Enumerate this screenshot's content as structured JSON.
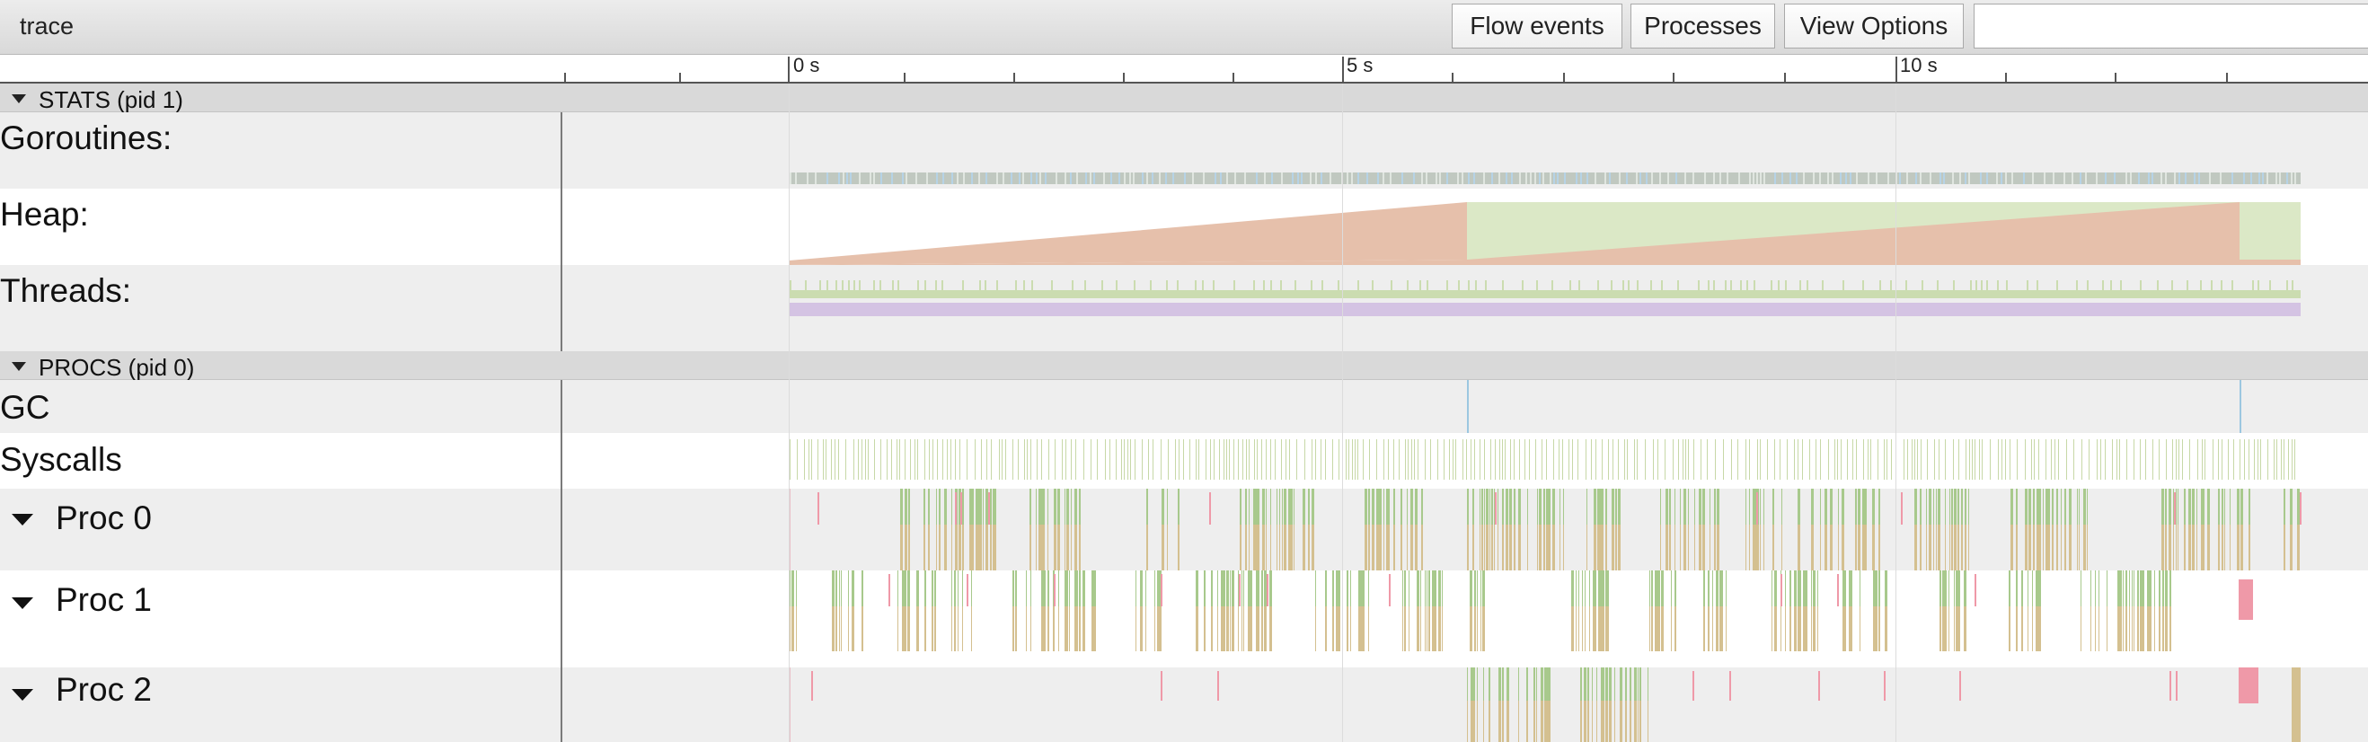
{
  "app": {
    "title": "trace"
  },
  "toolbar": {
    "flow_events": "Flow events",
    "processes": "Processes",
    "view_options": "View Options",
    "search_value": ""
  },
  "ruler": {
    "labels": [
      "0 s",
      "5 s",
      "10 s"
    ]
  },
  "sections": {
    "stats": "STATS (pid 1)",
    "procs": "PROCS (pid 0)"
  },
  "rows": {
    "goroutines": "Goroutines:",
    "heap": "Heap:",
    "threads": "Threads:",
    "gc": "GC",
    "syscalls": "Syscalls",
    "proc0": "Proc 0",
    "proc1": "Proc 1",
    "proc2": "Proc 2"
  },
  "colors": {
    "heap_alloc": "#e6c0ab",
    "heap_next_gc": "#dbe8c6",
    "goroutine_runnable": "#c0c8c0",
    "goroutine_gc": "#b6d3e6",
    "threads_running": "#d4c3e3",
    "threads_syscall": "#cbdcb0",
    "syscall": "#c7d8a7",
    "proc_run": "#a8c98c",
    "proc_user": "#d4c090",
    "proc_gc": "#ef99a8",
    "gc_marker": "#9cc7e0"
  }
}
